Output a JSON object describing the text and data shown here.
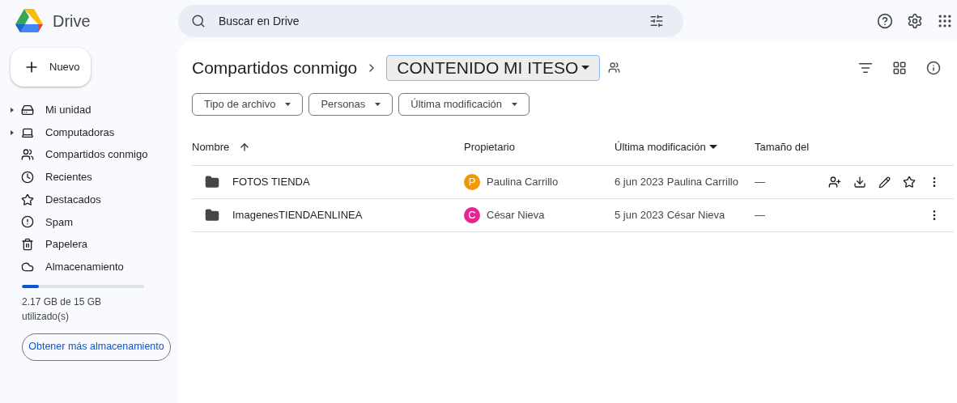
{
  "app": {
    "name": "Drive"
  },
  "search": {
    "placeholder": "Buscar en Drive"
  },
  "new_button": {
    "label": "Nuevo"
  },
  "sidebar": {
    "items": [
      {
        "label": "Mi unidad",
        "kind": "drive",
        "expandable": true
      },
      {
        "label": "Computadoras",
        "kind": "computers",
        "expandable": true
      },
      {
        "label": "Compartidos conmigo",
        "kind": "shared",
        "expandable": false
      },
      {
        "label": "Recientes",
        "kind": "recent",
        "expandable": false
      },
      {
        "label": "Destacados",
        "kind": "starred",
        "expandable": false
      },
      {
        "label": "Spam",
        "kind": "spam",
        "expandable": false
      },
      {
        "label": "Papelera",
        "kind": "trash",
        "expandable": false
      },
      {
        "label": "Almacenamiento",
        "kind": "storage",
        "expandable": false
      }
    ]
  },
  "storage": {
    "level": 0.14,
    "text": "2.17 GB de 15 GB utilizado(s)",
    "button": "Obtener más almacenamiento"
  },
  "breadcrumb": {
    "parent": "Compartidos conmigo",
    "current": "CONTENIDO MI ITESO"
  },
  "filters": [
    "Tipo de archivo",
    "Personas",
    "Última modificación"
  ],
  "table": {
    "columns": [
      {
        "label": "Nombre",
        "sorted": true,
        "descending": false
      },
      {
        "label": "Propietario",
        "sorted": false
      },
      {
        "label": "Última modificación",
        "sorted": true,
        "descending": true
      },
      {
        "label": "Tamaño del",
        "sorted": false
      }
    ],
    "rows": [
      {
        "name": "FOTOS TIENDA",
        "owner_initial": "P",
        "owner": "Paulina Carrillo",
        "color": "#f29900",
        "date": "6 jun 2023",
        "modified_by": "Paulina Carrillo",
        "size": "—",
        "hovered": true
      },
      {
        "name": "ImagenesTIENDAENLINEA",
        "owner_initial": "C",
        "owner": "César Nieva",
        "color": "#e52592",
        "date": "5 jun 2023",
        "modified_by": "César Nieva",
        "size": "—",
        "hovered": false
      }
    ]
  }
}
